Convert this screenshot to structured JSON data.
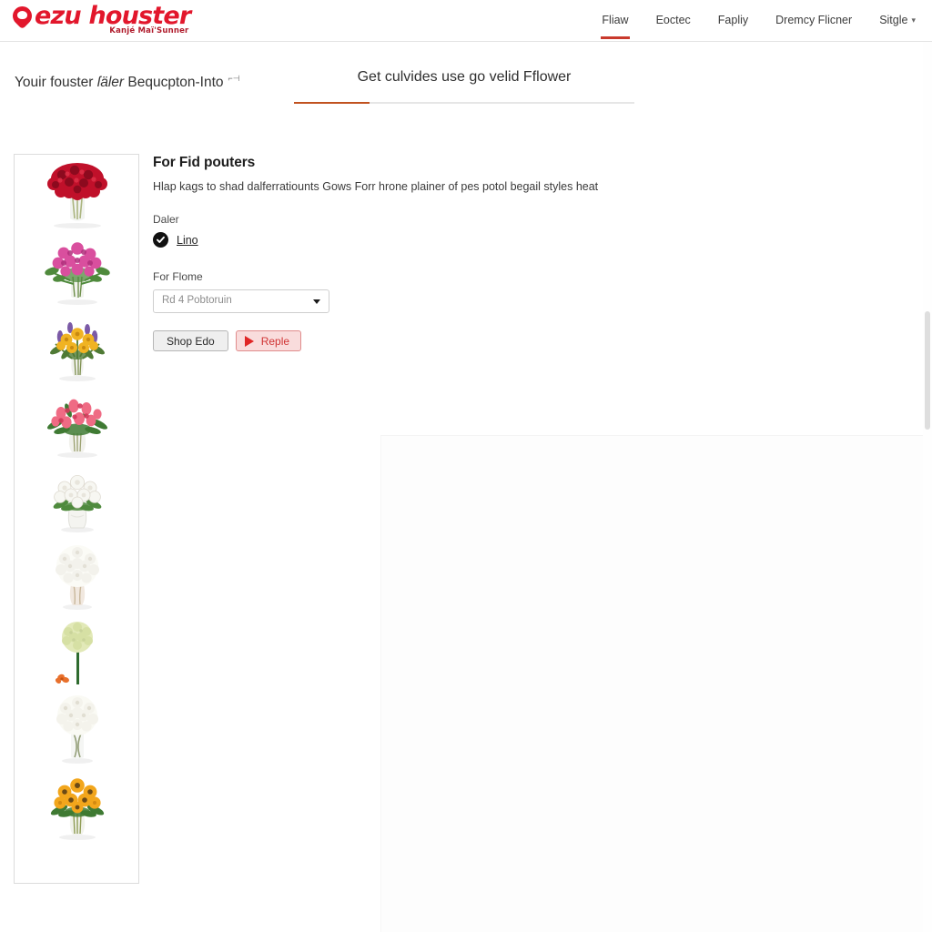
{
  "brand": {
    "name": "ezu houster",
    "tagline": "Kanjé Maï'Sunner",
    "accent_color": "#e2172c",
    "logo_icon": "location-pin-icon"
  },
  "topnav": {
    "items": [
      {
        "label": "Fliaw",
        "active": true,
        "has_caret": false
      },
      {
        "label": "Eoctec",
        "active": false,
        "has_caret": false
      },
      {
        "label": "Fapliy",
        "active": false,
        "has_caret": false
      },
      {
        "label": "Dremcy Flicner",
        "active": false,
        "has_caret": false
      },
      {
        "label": "Sitgle",
        "active": false,
        "has_caret": true
      }
    ],
    "active_underline_color": "#c9392c"
  },
  "breadcrumb": {
    "lead": "Youir fouster ",
    "emphasis": "ſäler",
    "trail": " Bequcpton-Into",
    "superscript": "⌐⊣"
  },
  "tab": {
    "label": "Get culvides use go velid Fflower",
    "underline_color": "#c1521f",
    "rail_color": "#e6e6e6"
  },
  "main": {
    "title": "For Fid pouters",
    "description": "Hlap kags to shad dalferratiounts Gows Forr hrone plainer of pes potol begail styles heat",
    "radio_group_label": "Daler",
    "radio_option_label": "Lino",
    "radio_checked": true,
    "select_label": "For Flome",
    "select_value": "Rd 4 Pobtoruin",
    "select_placeholder": "Rd 4 Pobtoruin",
    "buttons": {
      "secondary_label": "Shop Edo",
      "primary_label": "Reple",
      "primary_icon": "play-icon",
      "primary_color": "#d03434"
    }
  },
  "thumbnails": {
    "items": [
      {
        "name": "red-rose-bouquet",
        "flower_color": "#c0102a",
        "flower_dark": "#8c0a1e",
        "style": "dome-dense",
        "vase": "glass",
        "stems": "#8f9c54"
      },
      {
        "name": "pink-rose-bouquet",
        "flower_color": "#d94f9e",
        "flower_dark": "#b0307c",
        "style": "round-loose",
        "vase": "glass",
        "stems": "#5f8a3c"
      },
      {
        "name": "yellow-purple-mixed-bouquet",
        "flower_color": "#f0b323",
        "flower_dark": "#7b5aa6",
        "style": "mixed-spray",
        "vase": "glass",
        "stems": "#4f7a35"
      },
      {
        "name": "pink-lily-bouquet",
        "flower_color": "#ef6b84",
        "flower_dark": "#d43a5c",
        "style": "spiky-spray",
        "vase": "glass",
        "stems": "#3f7a33"
      },
      {
        "name": "white-carnation-bouquet",
        "flower_color": "#f7f7f2",
        "flower_dark": "#dedad0",
        "style": "round-loose",
        "vase": "ceramic",
        "stems": "#4f8a3d"
      },
      {
        "name": "white-pomander-bouquet",
        "flower_color": "#fbfbf6",
        "flower_dark": "#e3e0d6",
        "style": "pomander",
        "vase": "tapered-glass",
        "stems": "#b0a48c"
      },
      {
        "name": "green-allium-stem",
        "flower_color": "#e2e9b8",
        "flower_dark": "#c9d39a",
        "style": "single-stem",
        "vase": "none",
        "stems": "#2e6b2e"
      },
      {
        "name": "white-rose-globe-bouquet",
        "flower_color": "#fafaf4",
        "flower_dark": "#e1ded2",
        "style": "pomander",
        "vase": "glass",
        "stems": "#6b7a45"
      },
      {
        "name": "sunflower-bouquet",
        "flower_color": "#f2a61c",
        "flower_dark": "#c27a0c",
        "style": "round-loose",
        "vase": "glass",
        "stems": "#3f7a33"
      }
    ]
  },
  "scrollbar": {
    "name": "page-scrollbar",
    "thumb_color": "#dedede"
  }
}
